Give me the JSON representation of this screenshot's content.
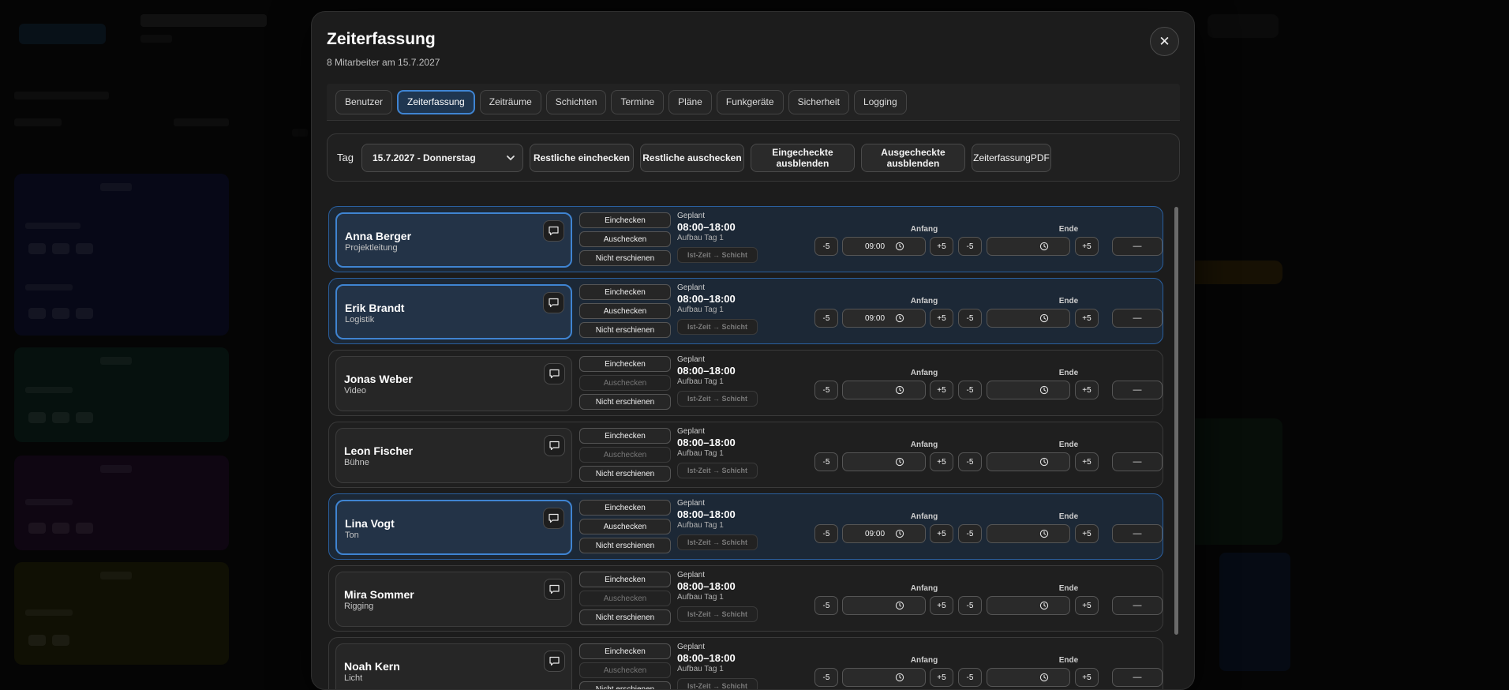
{
  "modal": {
    "title": "Zeiterfassung",
    "subtitle": "8 Mitarbeiter am 15.7.2027",
    "close_label": "✕"
  },
  "tabs": [
    {
      "label": "Benutzer",
      "active": false
    },
    {
      "label": "Zeiterfassung",
      "active": true
    },
    {
      "label": "Zeiträume",
      "active": false
    },
    {
      "label": "Schichten",
      "active": false
    },
    {
      "label": "Termine",
      "active": false
    },
    {
      "label": "Pläne",
      "active": false
    },
    {
      "label": "Funkgeräte",
      "active": false
    },
    {
      "label": "Sicherheit",
      "active": false
    },
    {
      "label": "Logging",
      "active": false
    }
  ],
  "toolbar": {
    "day_label": "Tag",
    "day_value": "15.7.2027 - Donnerstag",
    "buttons": [
      "Restliche einchecken",
      "Restliche auschecken",
      "Eingecheckte ausblenden",
      "Ausgecheckte ausblenden"
    ],
    "pdf_label": "ZeiterfassungPDF"
  },
  "labels": {
    "checkin": "Einchecken",
    "checkout": "Auschecken",
    "noshow": "Nicht erschienen",
    "planned": "Geplant",
    "ist_to_shift": "Ist-Zeit → Schicht",
    "start": "Anfang",
    "end": "Ende",
    "minus5": "-5",
    "plus5": "+5",
    "dash": "—"
  },
  "employees": [
    {
      "name": "Anna Berger",
      "role": "Projektleitung",
      "active": true,
      "checkout_enabled": true,
      "planned": "08:00–18:00",
      "shift": "Aufbau Tag 1",
      "start_time": "09:00",
      "end_time": ""
    },
    {
      "name": "Erik Brandt",
      "role": "Logistik",
      "active": true,
      "checkout_enabled": true,
      "planned": "08:00–18:00",
      "shift": "Aufbau Tag 1",
      "start_time": "09:00",
      "end_time": ""
    },
    {
      "name": "Jonas Weber",
      "role": "Video",
      "active": false,
      "checkout_enabled": false,
      "planned": "08:00–18:00",
      "shift": "Aufbau Tag 1",
      "start_time": "",
      "end_time": ""
    },
    {
      "name": "Leon Fischer",
      "role": "Bühne",
      "active": false,
      "checkout_enabled": false,
      "planned": "08:00–18:00",
      "shift": "Aufbau Tag 1",
      "start_time": "",
      "end_time": ""
    },
    {
      "name": "Lina Vogt",
      "role": "Ton",
      "active": true,
      "checkout_enabled": true,
      "planned": "08:00–18:00",
      "shift": "Aufbau Tag 1",
      "start_time": "09:00",
      "end_time": ""
    },
    {
      "name": "Mira Sommer",
      "role": "Rigging",
      "active": false,
      "checkout_enabled": false,
      "planned": "08:00–18:00",
      "shift": "Aufbau Tag 1",
      "start_time": "",
      "end_time": ""
    },
    {
      "name": "Noah Kern",
      "role": "Licht",
      "active": false,
      "checkout_enabled": false,
      "planned": "08:00–18:00",
      "shift": "Aufbau Tag 1",
      "start_time": "",
      "end_time": ""
    }
  ],
  "colors": {
    "accent": "#3f84d2",
    "active_row_bg": "#1c2836",
    "modal_bg": "#1c1c1c"
  }
}
